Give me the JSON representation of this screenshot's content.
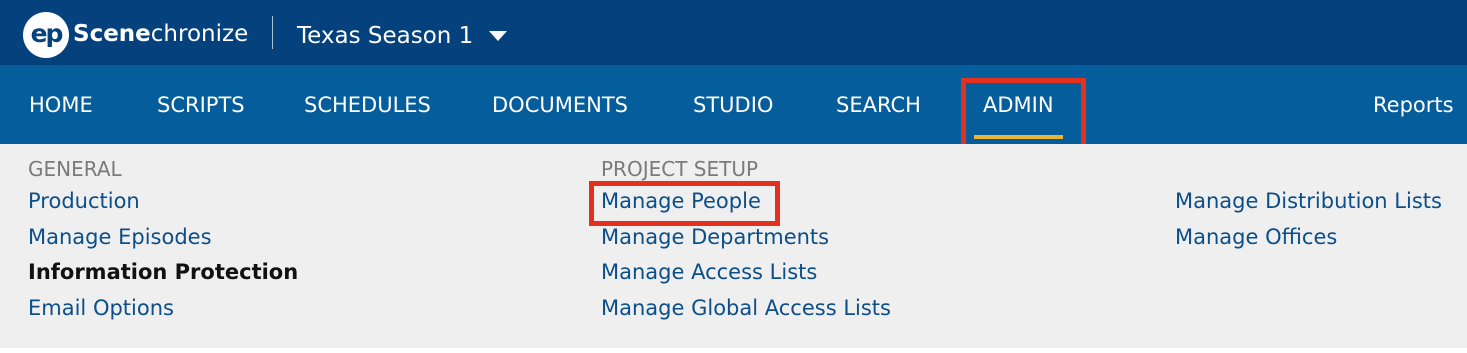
{
  "header": {
    "logo_badge": "ep",
    "brand_bold": "Scene",
    "brand_rest": "chronize",
    "project_name": "Texas Season 1",
    "caret_icon": "caret-down-icon"
  },
  "nav": {
    "items": [
      {
        "label": "HOME"
      },
      {
        "label": "SCRIPTS"
      },
      {
        "label": "SCHEDULES"
      },
      {
        "label": "DOCUMENTS"
      },
      {
        "label": "STUDIO"
      },
      {
        "label": "SEARCH"
      },
      {
        "label": "ADMIN",
        "active": true
      }
    ],
    "reports_label": "Reports",
    "active_indicator_color": "#e8b53a"
  },
  "menu": {
    "general": {
      "heading": "GENERAL",
      "links": [
        "Production",
        "Manage Episodes",
        "Information Protection",
        "Email Options"
      ]
    },
    "project_setup": {
      "heading": "PROJECT SETUP",
      "links": [
        "Manage People",
        "Manage Departments",
        "Manage Access Lists",
        "Manage Global Access Lists"
      ]
    },
    "third": {
      "links": [
        "Manage Distribution Lists",
        "Manage Offices"
      ]
    }
  },
  "colors": {
    "topbar": "#04417d",
    "navbar": "#065d9c",
    "highlight": "#e2321f",
    "link": "#0b4e89"
  }
}
